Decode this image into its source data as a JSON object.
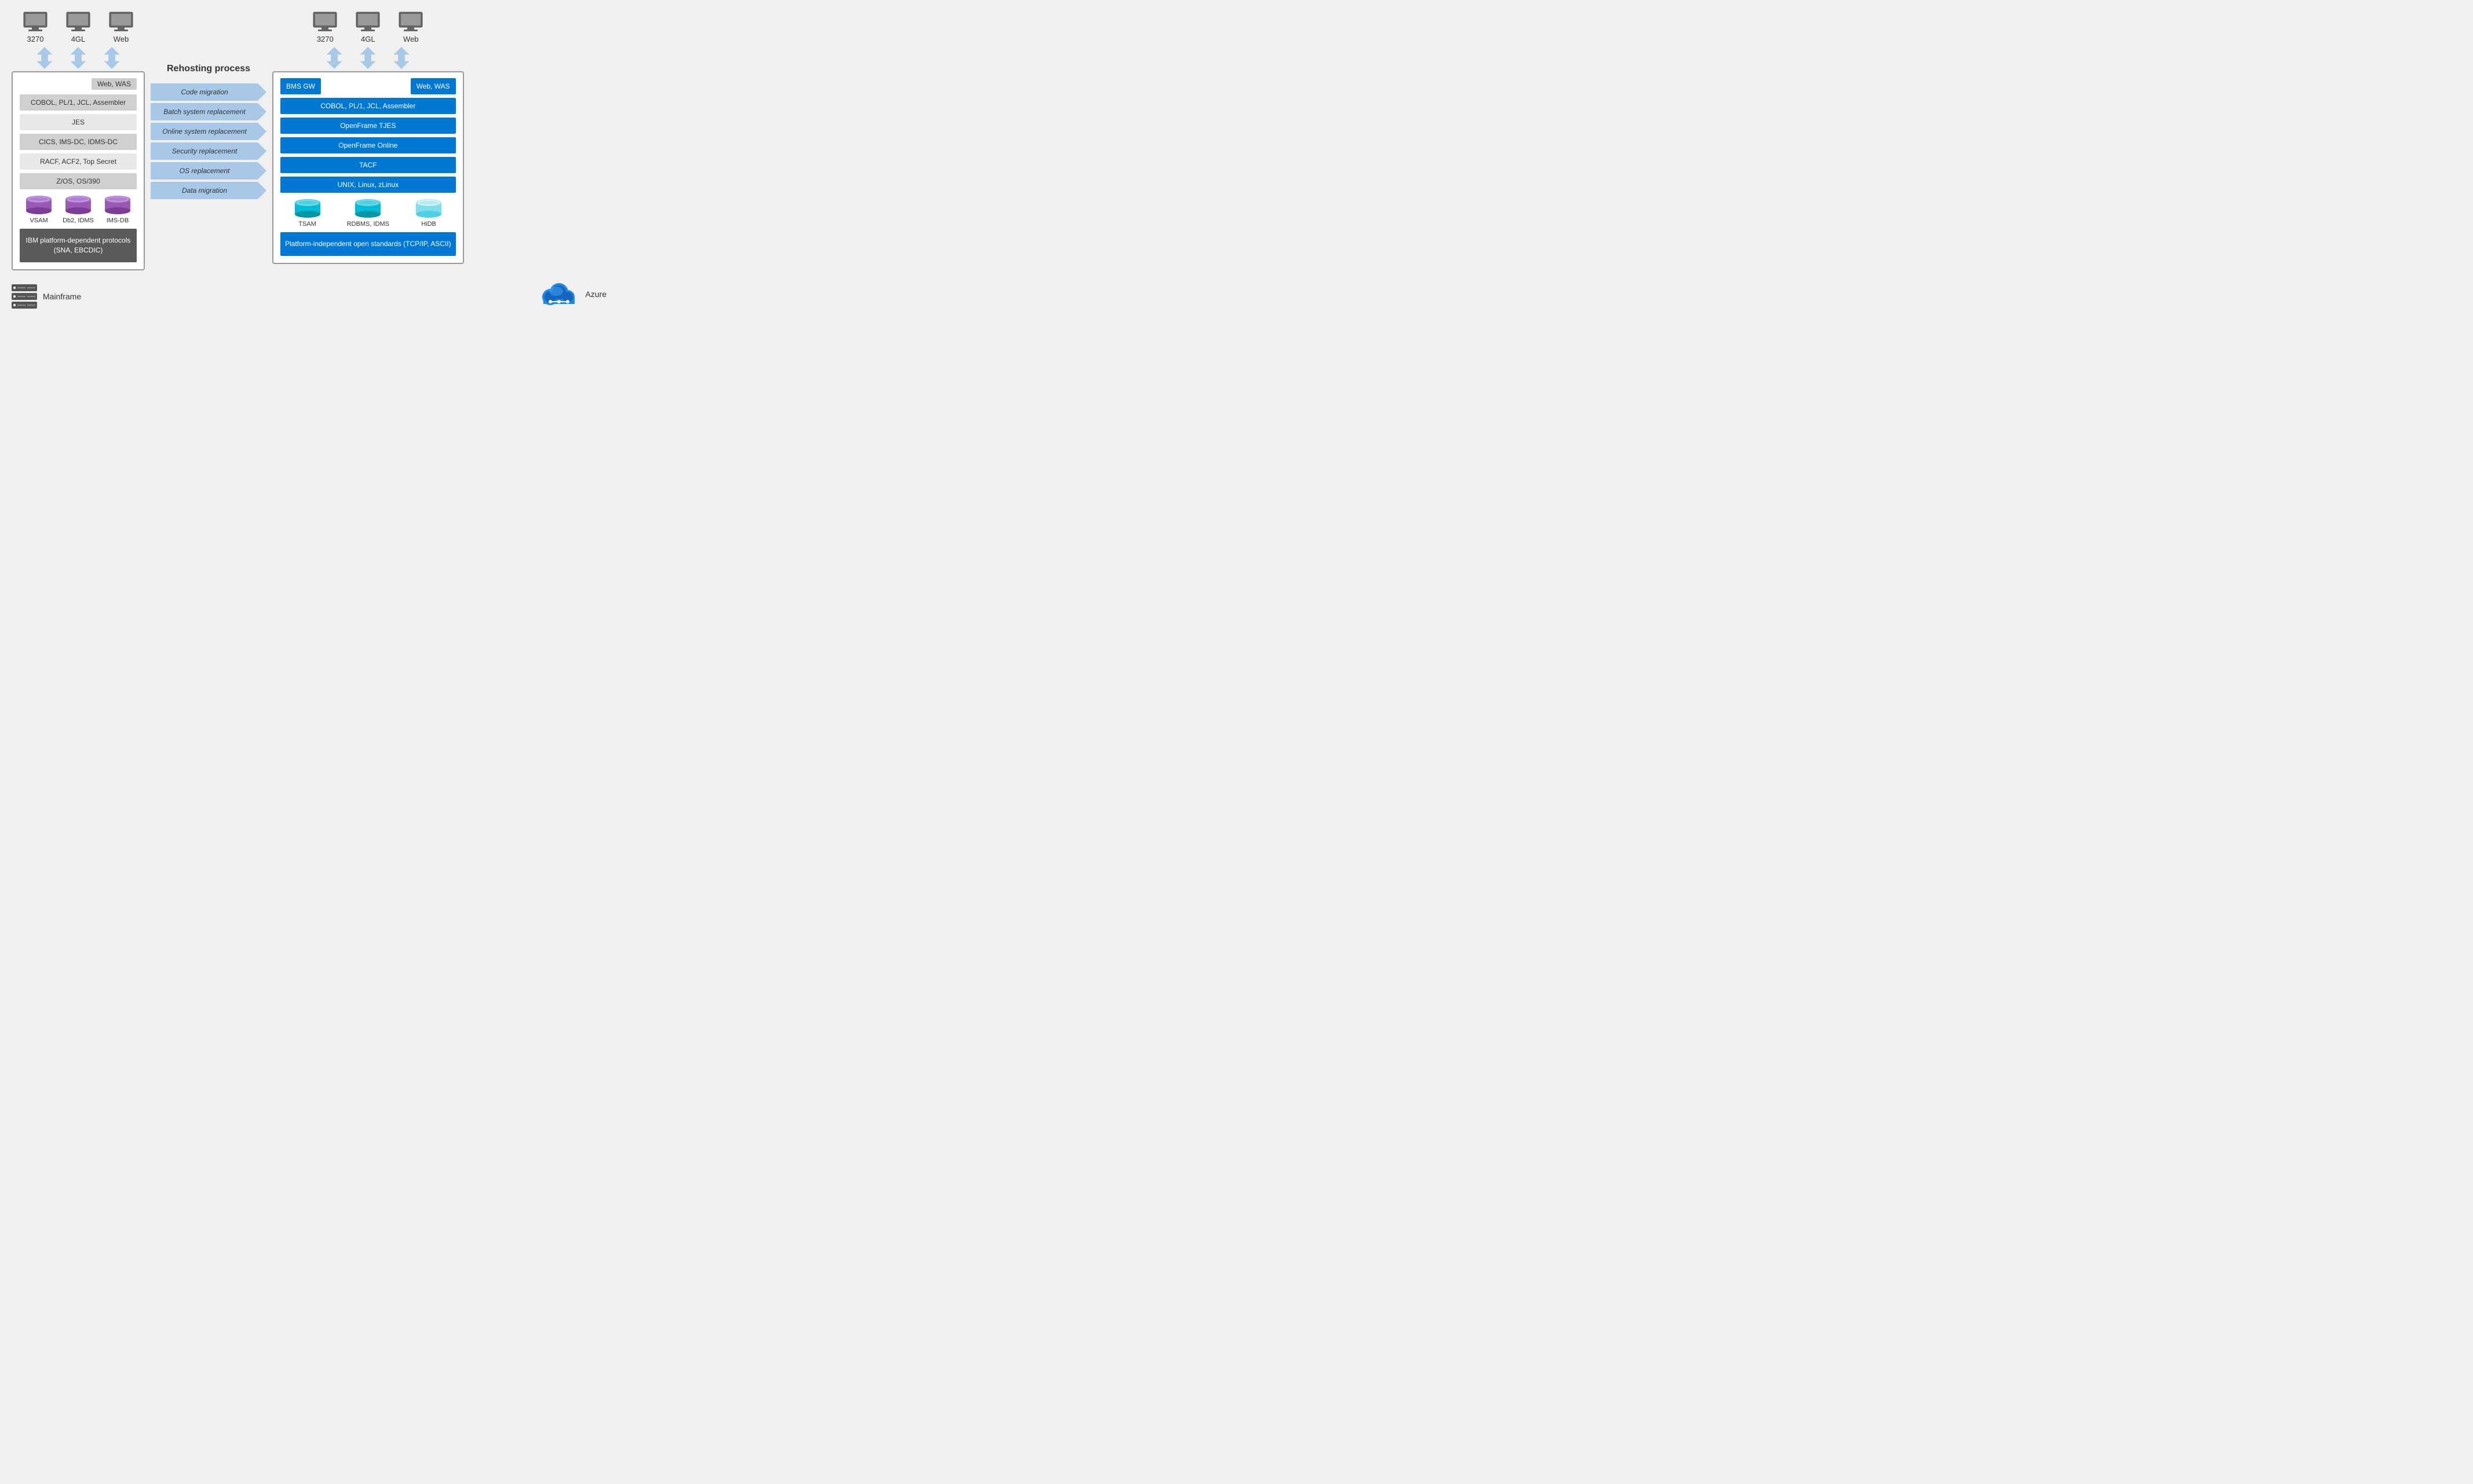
{
  "left": {
    "terminals": [
      {
        "label": "3270"
      },
      {
        "label": "4GL"
      },
      {
        "label": "Web"
      }
    ],
    "web_was": "Web, WAS",
    "rows": [
      "COBOL, PL/1, JCL, Assembler",
      "JES",
      "CICS, IMS-DC, IDMS-DC",
      "RACF, ACF2, Top Secret",
      "Z/OS, OS/390"
    ],
    "databases": [
      {
        "label": "VSAM",
        "color": "purple"
      },
      {
        "label": "Db2, IDMS",
        "color": "purple"
      },
      {
        "label": "IMS-DB",
        "color": "purple"
      }
    ],
    "ibm_platform": "IBM platform-dependent\nprotocols (SNA, EBCDIC)"
  },
  "middle": {
    "title": "Rehosting process",
    "steps": [
      "Code migration",
      "Batch system replacement",
      "Online system replacement",
      "Security replacement",
      "OS replacement",
      "Data migration"
    ]
  },
  "right": {
    "terminals": [
      {
        "label": "3270"
      },
      {
        "label": "4GL"
      },
      {
        "label": "Web"
      }
    ],
    "bms_gw": "BMS GW",
    "web_was": "Web, WAS",
    "rows": [
      "COBOL, PL/1, JCL, Assembler",
      "OpenFrame TJES",
      "OpenFrame Online",
      "TACF",
      "UNIX, Linux, zLinux"
    ],
    "databases": [
      {
        "label": "TSAM",
        "color": "cyan"
      },
      {
        "label": "RDBMS, IDMS",
        "color": "cyan"
      },
      {
        "label": "HiDB",
        "color": "lightcyan"
      }
    ],
    "platform": "Platform-independent\nopen standards (TCP/IP, ASCII)"
  },
  "bottom": {
    "mainframe_label": "Mainframe",
    "azure_label": "Azure"
  }
}
